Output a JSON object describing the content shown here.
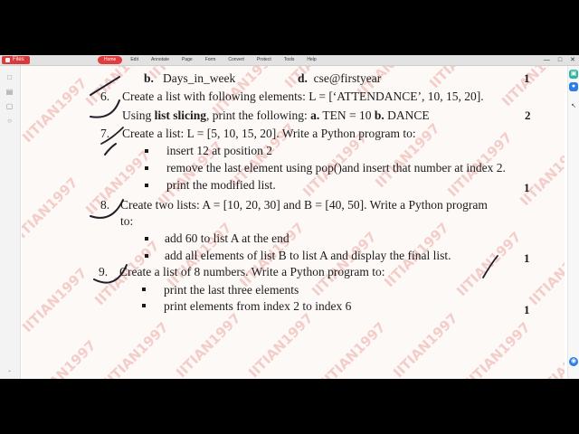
{
  "toolbar": {
    "files_label": "Files",
    "menu": [
      "Home",
      "Edit",
      "Annotate",
      "Page",
      "Form",
      "Convert",
      "Protect",
      "Tools",
      "Help"
    ],
    "active_menu": "Home"
  },
  "window_controls": [
    "—",
    "□",
    "✕"
  ],
  "side_icons": [
    "bookmark-icon",
    "layers-icon",
    "comment-icon",
    "attachment-icon"
  ],
  "watermark": "IITIAN1997",
  "doc": {
    "top_line": {
      "b_label": "b.",
      "b_text": "Days_in_week",
      "d_label": "d.",
      "d_text": "cse@firstyear",
      "marks": "1"
    },
    "q6": {
      "num": "6.",
      "line1": "Create a list with following elements: L = [‘ATTENDANCE’, 10, 15, 20].",
      "line2_a": "Using ",
      "line2_bold": "list slicing",
      "line2_b": ", print the following: ",
      "opt_a_label": "a.",
      "opt_a_text": " TEN = 10  ",
      "opt_b_label": "b.",
      "opt_b_text": " DANCE",
      "marks": "2"
    },
    "q7": {
      "num": "7.",
      "line1": "Create a list: L = [5, 10, 15, 20]. Write a Python program to:",
      "bullets": [
        "insert 12 at position 2",
        "remove the last element using pop()and insert that number at index 2.",
        "print the modified list."
      ],
      "marks": "1"
    },
    "q8": {
      "num": "8.",
      "line1": "Create two lists: A = [10, 20, 30] and B = [40, 50]. Write a Python program",
      "line2": "to:",
      "bullets": [
        "add 60 to list A at the end",
        "add all elements of list B to list A and display the final list."
      ],
      "marks": "1"
    },
    "q9": {
      "num": "9.",
      "line1": "Create a list of 8 numbers. Write a Python program to:",
      "bullets": [
        "print the last three elements",
        "print elements from index 2 to index 6"
      ],
      "marks": "1"
    }
  }
}
